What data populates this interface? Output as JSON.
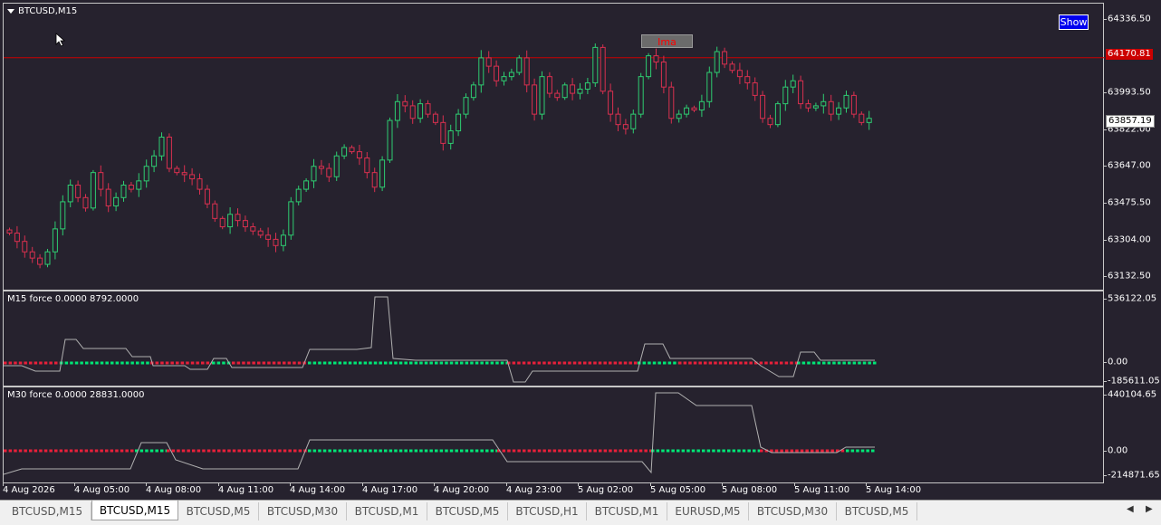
{
  "main_pane": {
    "title": "BTCUSD,M15",
    "show_button": "Show",
    "ima_label": "Ima"
  },
  "m15_pane": {
    "title": "M15 force  0.0000 8792.0000"
  },
  "m30_pane": {
    "title": "M30 force  0.0000 28831.0000"
  },
  "price_axis": [
    "64336.50",
    "63993.50",
    "63822.00",
    "63647.00",
    "63475.50",
    "63304.00",
    "63132.50"
  ],
  "price_line_label": "64170.81",
  "bid_label": "63857.19",
  "m15_axis": [
    "536122.05",
    "0.00",
    "-185611.05"
  ],
  "m30_axis": [
    "440104.65",
    "0.00",
    "-214871.65"
  ],
  "time_axis": [
    "4 Aug 2026",
    "4 Aug 05:00",
    "4 Aug 08:00",
    "4 Aug 11:00",
    "4 Aug 14:00",
    "4 Aug 17:00",
    "4 Aug 20:00",
    "4 Aug 23:00",
    "5 Aug 02:00",
    "5 Aug 05:00",
    "5 Aug 08:00",
    "5 Aug 11:00",
    "5 Aug 14:00"
  ],
  "tabs": [
    "BTCUSD,M15",
    "BTCUSD,M15",
    "BTCUSD,M5",
    "BTCUSD,M30",
    "BTCUSD,M1",
    "BTCUSD,M5",
    "BTCUSD,H1",
    "BTCUSD,M1",
    "EURUSD,M5",
    "BTCUSD,M30",
    "BTCUSD,M5"
  ],
  "active_tab": 1,
  "colors": {
    "background": "#26222e",
    "bull_candle": "#2ecc71",
    "bear_candle": "#d9304f",
    "price_line": "#cc0000",
    "force_positive": "#00e676",
    "force_negative": "#e8203a",
    "force_line": "#b0b0b0"
  },
  "icons": {
    "scroll_left": "triangle-left-icon",
    "scroll_right": "triangle-right-icon",
    "cursor": "mouse-pointer-icon",
    "title_menu": "triangle-down-icon"
  },
  "chart_data": {
    "type": "candlestick",
    "symbol": "BTCUSD",
    "timeframe": "M15",
    "ylim": [
      63050,
      64430
    ],
    "price_line": 64170.81,
    "bid": 63857.19,
    "candles_close": [
      63330,
      63290,
      63240,
      63210,
      63180,
      63240,
      63350,
      63480,
      63560,
      63500,
      63450,
      63620,
      63540,
      63460,
      63500,
      63560,
      63540,
      63580,
      63650,
      63700,
      63790,
      63640,
      63620,
      63610,
      63590,
      63540,
      63470,
      63400,
      63360,
      63420,
      63390,
      63360,
      63340,
      63320,
      63300,
      63270,
      63320,
      63480,
      63540,
      63580,
      63650,
      63640,
      63600,
      63700,
      63740,
      63720,
      63690,
      63620,
      63550,
      63680,
      63870,
      63960,
      63940,
      63880,
      63950,
      63900,
      63860,
      63760,
      63820,
      63900,
      63980,
      64040,
      64170,
      64130,
      64060,
      64080,
      64100,
      64170,
      64040,
      63900,
      64080,
      64000,
      63980,
      64040,
      64000,
      64020,
      64050,
      64220,
      64010,
      63900,
      63850,
      63830,
      63900,
      64080,
      64180,
      64150,
      64030,
      63880,
      63900,
      63930,
      63920,
      63960,
      64100,
      64200,
      64140,
      64110,
      64080,
      64050,
      63990,
      63880,
      63850,
      63950,
      64030,
      64060,
      63950,
      63930,
      63940,
      63960,
      63900,
      63930,
      63990,
      63900,
      63860,
      63880
    ]
  }
}
